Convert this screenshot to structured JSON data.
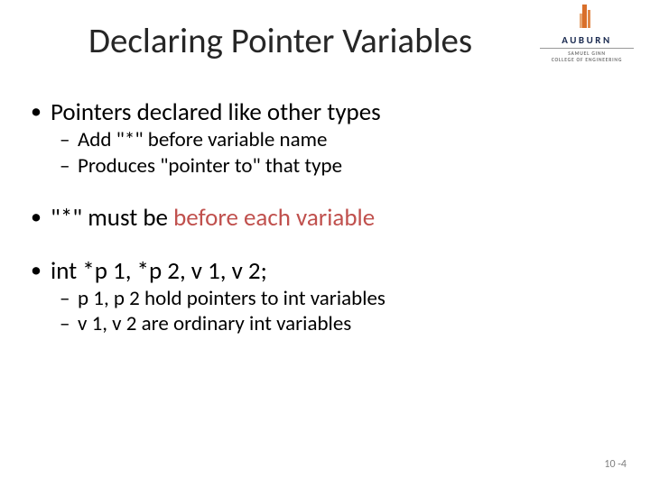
{
  "title": "Declaring Pointer Variables",
  "logo": {
    "university": "AUBURN",
    "college_line1": "SAMUEL GINN",
    "college_line2": "COLLEGE OF ENGINEERING"
  },
  "bullets": {
    "b1": "Pointers declared like other types",
    "b1a": "Add \"*\" before variable name",
    "b1b": "Produces \"pointer to\" that type",
    "b2_pre": "\"*\" must be ",
    "b2_red": "before each variable",
    "b3": "int *p 1, *p 2, v 1, v 2;",
    "b3a": "p 1, p 2 hold pointers to int variables",
    "b3b": "v 1, v 2 are ordinary int variables"
  },
  "slide_number": "10 -4"
}
